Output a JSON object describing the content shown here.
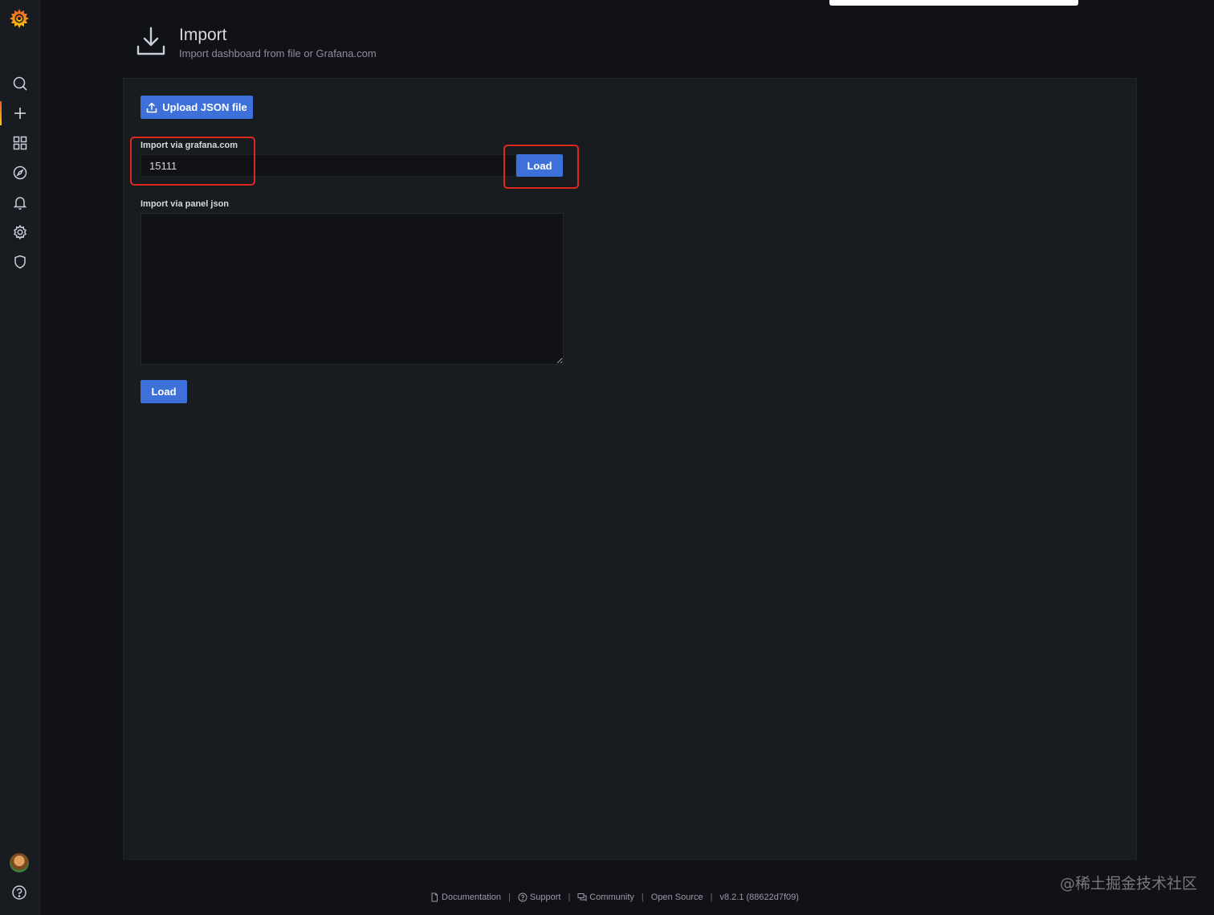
{
  "sidebar": {
    "items": [
      {
        "name": "search",
        "icon": "search-icon"
      },
      {
        "name": "create",
        "icon": "plus-icon",
        "active": true
      },
      {
        "name": "dashboards",
        "icon": "apps-icon"
      },
      {
        "name": "explore",
        "icon": "compass-icon"
      },
      {
        "name": "alerting",
        "icon": "bell-icon"
      },
      {
        "name": "configuration",
        "icon": "cog-icon"
      },
      {
        "name": "server-admin",
        "icon": "shield-icon"
      }
    ],
    "brand_colors": [
      "#f05a28",
      "#fbca0a"
    ]
  },
  "header": {
    "title": "Import",
    "subtitle": "Import dashboard from file or Grafana.com"
  },
  "import": {
    "upload_label": "Upload JSON file",
    "grafana_label": "Import via grafana.com",
    "grafana_value": "15111",
    "load_label": "Load",
    "panel_json_label": "Import via panel json",
    "panel_json_value": "",
    "load_label_bottom": "Load"
  },
  "footer": {
    "documentation": "Documentation",
    "support": "Support",
    "community": "Community",
    "open_source": "Open Source",
    "version": "v8.2.1 (88622d7f09)",
    "separator": "|"
  },
  "watermark": "@稀土掘金技术社区",
  "colors": {
    "primary_button": "#3d71d9",
    "highlight": "#e0291d",
    "background": "#111217",
    "panel": "#181b1f"
  }
}
